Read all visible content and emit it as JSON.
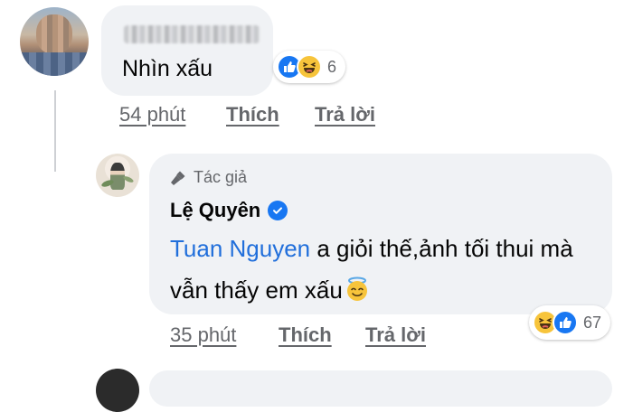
{
  "comments": [
    {
      "text": "Nhìn xấu",
      "reaction_count": "6",
      "reactions": [
        "like-icon",
        "haha-icon"
      ],
      "time": "54 phút",
      "like_label": "Thích",
      "reply_label": "Trả lời"
    }
  ],
  "reply": {
    "author_badge": "Tác giả",
    "author_name": "Lệ Quyên",
    "verified": true,
    "mention": "Tuan Nguyen",
    "text": " a giỏi thế,ảnh tối thui mà vẫn thấy em xấu",
    "emoji": "innocent-halo-face",
    "reaction_count": "67",
    "reactions": [
      "haha-icon",
      "like-icon"
    ],
    "time": "35 phút",
    "like_label": "Thích",
    "reply_label": "Trả lời"
  },
  "colors": {
    "bubble": "#f0f2f5",
    "meta_text": "#65676b",
    "mention": "#216fdb",
    "like_blue": "#1877f2",
    "haha_yellow": "#f7c43b"
  }
}
